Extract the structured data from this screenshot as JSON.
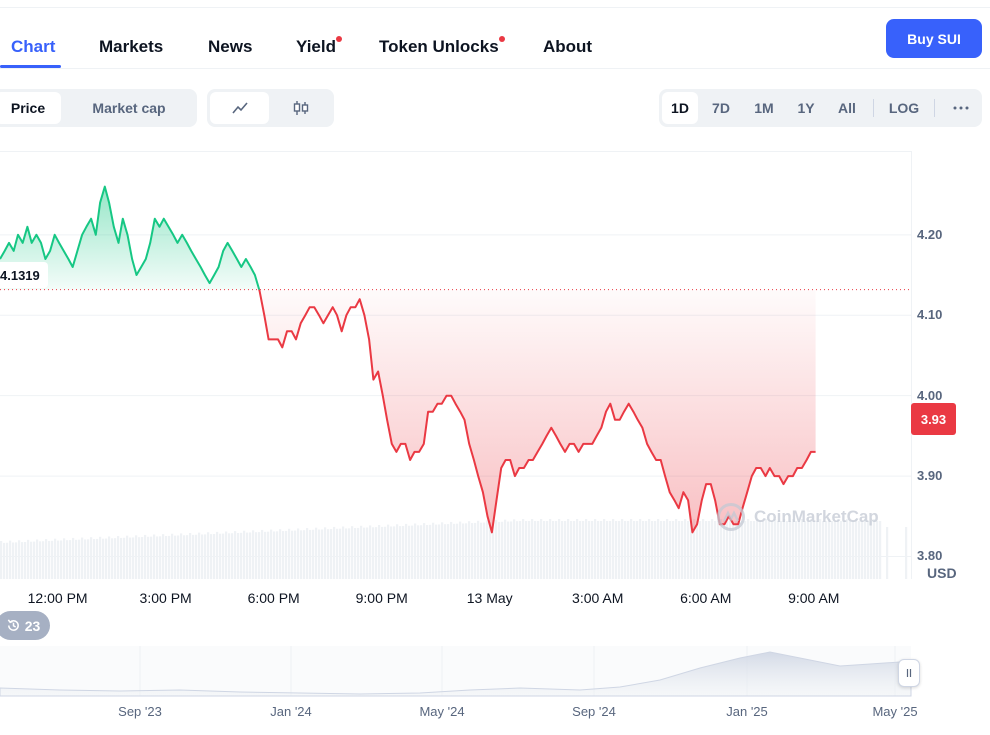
{
  "tabs": [
    {
      "label": "Chart",
      "active": true,
      "dot": false
    },
    {
      "label": "Markets",
      "active": false,
      "dot": false
    },
    {
      "label": "News",
      "active": false,
      "dot": false
    },
    {
      "label": "Yield",
      "active": false,
      "dot": true
    },
    {
      "label": "Token Unlocks",
      "active": false,
      "dot": true
    },
    {
      "label": "About",
      "active": false,
      "dot": false
    }
  ],
  "buy_button": "Buy SUI",
  "metric_toggle": {
    "price": "Price",
    "market_cap": "Market cap",
    "selected": "price"
  },
  "chart_style_icons": {
    "line": "line-chart-icon",
    "candle": "candlestick-icon",
    "selected": "line"
  },
  "ranges": [
    "1D",
    "7D",
    "1M",
    "1Y",
    "All"
  ],
  "selected_range": "1D",
  "log_label": "LOG",
  "more_icon": "more-horizontal-icon",
  "watermark": "CoinMarketCap",
  "history_badge": {
    "icon": "history-icon",
    "count": "23"
  },
  "colors": {
    "up": "#16c784",
    "down": "#ea3943",
    "accent": "#3861fb"
  },
  "chart_data": {
    "type": "line",
    "unit": "USD",
    "y_ticks": [
      "4.20",
      "4.10",
      "4.00",
      "3.90",
      "3.80"
    ],
    "ylim": [
      3.772,
      4.303
    ],
    "reference_price": 4.1319,
    "reference_label": "4.1319",
    "current_price": 3.93,
    "current_label": "3.93",
    "x_ticks": [
      "12:00 PM",
      "3:00 PM",
      "6:00 PM",
      "9:00 PM",
      "13 May",
      "3:00 AM",
      "6:00 AM",
      "9:00 AM"
    ],
    "x_tick_hours": [
      0,
      3,
      6,
      9,
      12,
      15,
      18,
      21
    ],
    "xlim_hours": [
      -1.6,
      23.7
    ],
    "series": [
      {
        "points": [
          [
            -1.6,
            4.17
          ],
          [
            -1.47,
            4.18
          ],
          [
            -1.35,
            4.19
          ],
          [
            -1.22,
            4.18
          ],
          [
            -1.1,
            4.2
          ],
          [
            -0.97,
            4.19
          ],
          [
            -0.84,
            4.21
          ],
          [
            -0.72,
            4.19
          ],
          [
            -0.59,
            4.2
          ],
          [
            -0.46,
            4.19
          ],
          [
            -0.34,
            4.17
          ],
          [
            -0.21,
            4.18
          ],
          [
            -0.08,
            4.2
          ],
          [
            0.04,
            4.19
          ],
          [
            0.17,
            4.18
          ],
          [
            0.3,
            4.17
          ],
          [
            0.42,
            4.16
          ],
          [
            0.55,
            4.18
          ],
          [
            0.68,
            4.2
          ],
          [
            0.8,
            4.21
          ],
          [
            0.93,
            4.22
          ],
          [
            1.06,
            4.2
          ],
          [
            1.18,
            4.24
          ],
          [
            1.31,
            4.26
          ],
          [
            1.43,
            4.24
          ],
          [
            1.56,
            4.21
          ],
          [
            1.69,
            4.19
          ],
          [
            1.81,
            4.22
          ],
          [
            1.94,
            4.2
          ],
          [
            2.07,
            4.17
          ],
          [
            2.19,
            4.15
          ],
          [
            2.32,
            4.16
          ],
          [
            2.45,
            4.17
          ],
          [
            2.57,
            4.19
          ],
          [
            2.7,
            4.22
          ],
          [
            2.83,
            4.21
          ],
          [
            2.95,
            4.22
          ],
          [
            3.08,
            4.21
          ],
          [
            3.21,
            4.2
          ],
          [
            3.33,
            4.19
          ],
          [
            3.46,
            4.2
          ],
          [
            3.59,
            4.19
          ],
          [
            3.71,
            4.18
          ],
          [
            3.84,
            4.17
          ],
          [
            3.97,
            4.16
          ],
          [
            4.09,
            4.15
          ],
          [
            4.22,
            4.14
          ],
          [
            4.35,
            4.15
          ],
          [
            4.47,
            4.16
          ],
          [
            4.6,
            4.18
          ],
          [
            4.72,
            4.19
          ],
          [
            4.85,
            4.18
          ],
          [
            4.98,
            4.17
          ],
          [
            5.1,
            4.16
          ],
          [
            5.23,
            4.17
          ],
          [
            5.36,
            4.16
          ],
          [
            5.48,
            4.15
          ],
          [
            5.61,
            4.13
          ],
          [
            5.74,
            4.1
          ],
          [
            5.86,
            4.07
          ],
          [
            5.99,
            4.07
          ],
          [
            6.12,
            4.07
          ],
          [
            6.24,
            4.06
          ],
          [
            6.37,
            4.08
          ],
          [
            6.5,
            4.08
          ],
          [
            6.62,
            4.07
          ],
          [
            6.75,
            4.09
          ],
          [
            6.88,
            4.1
          ],
          [
            7.0,
            4.11
          ],
          [
            7.13,
            4.11
          ],
          [
            7.26,
            4.1
          ],
          [
            7.38,
            4.09
          ],
          [
            7.51,
            4.1
          ],
          [
            7.64,
            4.11
          ],
          [
            7.76,
            4.1
          ],
          [
            7.89,
            4.08
          ],
          [
            8.02,
            4.1
          ],
          [
            8.14,
            4.11
          ],
          [
            8.27,
            4.11
          ],
          [
            8.39,
            4.12
          ],
          [
            8.52,
            4.1
          ],
          [
            8.65,
            4.07
          ],
          [
            8.77,
            4.02
          ],
          [
            8.9,
            4.03
          ],
          [
            9.03,
            4.0
          ],
          [
            9.15,
            3.97
          ],
          [
            9.28,
            3.94
          ],
          [
            9.41,
            3.93
          ],
          [
            9.53,
            3.94
          ],
          [
            9.66,
            3.94
          ],
          [
            9.79,
            3.92
          ],
          [
            9.91,
            3.93
          ],
          [
            10.04,
            3.93
          ],
          [
            10.17,
            3.94
          ],
          [
            10.29,
            3.98
          ],
          [
            10.42,
            3.98
          ],
          [
            10.55,
            3.99
          ],
          [
            10.67,
            3.99
          ],
          [
            10.8,
            4.0
          ],
          [
            10.93,
            4.0
          ],
          [
            11.05,
            3.99
          ],
          [
            11.18,
            3.98
          ],
          [
            11.3,
            3.97
          ],
          [
            11.43,
            3.94
          ],
          [
            11.56,
            3.92
          ],
          [
            11.68,
            3.9
          ],
          [
            11.81,
            3.88
          ],
          [
            11.94,
            3.85
          ],
          [
            12.06,
            3.83
          ],
          [
            12.19,
            3.87
          ],
          [
            12.32,
            3.91
          ],
          [
            12.44,
            3.92
          ],
          [
            12.57,
            3.92
          ],
          [
            12.7,
            3.9
          ],
          [
            12.82,
            3.91
          ],
          [
            12.95,
            3.91
          ],
          [
            13.08,
            3.92
          ],
          [
            13.2,
            3.92
          ],
          [
            13.33,
            3.93
          ],
          [
            13.46,
            3.94
          ],
          [
            13.58,
            3.95
          ],
          [
            13.71,
            3.96
          ],
          [
            13.84,
            3.95
          ],
          [
            13.96,
            3.94
          ],
          [
            14.09,
            3.93
          ],
          [
            14.22,
            3.94
          ],
          [
            14.34,
            3.94
          ],
          [
            14.47,
            3.93
          ],
          [
            14.6,
            3.94
          ],
          [
            14.72,
            3.94
          ],
          [
            14.85,
            3.94
          ],
          [
            14.97,
            3.95
          ],
          [
            15.1,
            3.96
          ],
          [
            15.23,
            3.98
          ],
          [
            15.35,
            3.99
          ],
          [
            15.48,
            3.97
          ],
          [
            15.61,
            3.97
          ],
          [
            15.73,
            3.98
          ],
          [
            15.86,
            3.99
          ],
          [
            15.99,
            3.98
          ],
          [
            16.11,
            3.97
          ],
          [
            16.24,
            3.96
          ],
          [
            16.37,
            3.94
          ],
          [
            16.49,
            3.93
          ],
          [
            16.62,
            3.92
          ],
          [
            16.75,
            3.92
          ],
          [
            16.87,
            3.9
          ],
          [
            17.0,
            3.88
          ],
          [
            17.13,
            3.87
          ],
          [
            17.25,
            3.86
          ],
          [
            17.38,
            3.88
          ],
          [
            17.51,
            3.87
          ],
          [
            17.63,
            3.83
          ],
          [
            17.76,
            3.84
          ],
          [
            17.89,
            3.87
          ],
          [
            18.01,
            3.89
          ],
          [
            18.14,
            3.89
          ],
          [
            18.26,
            3.87
          ],
          [
            18.39,
            3.84
          ],
          [
            18.52,
            3.84
          ],
          [
            18.64,
            3.85
          ],
          [
            18.77,
            3.84
          ],
          [
            18.9,
            3.84
          ],
          [
            19.02,
            3.86
          ],
          [
            19.15,
            3.88
          ],
          [
            19.28,
            3.9
          ],
          [
            19.4,
            3.91
          ],
          [
            19.53,
            3.91
          ],
          [
            19.66,
            3.9
          ],
          [
            19.78,
            3.91
          ],
          [
            19.91,
            3.9
          ],
          [
            20.04,
            3.9
          ],
          [
            20.16,
            3.89
          ],
          [
            20.29,
            3.9
          ],
          [
            20.42,
            3.9
          ],
          [
            20.54,
            3.91
          ],
          [
            20.67,
            3.91
          ],
          [
            20.8,
            3.92
          ],
          [
            20.92,
            3.93
          ],
          [
            21.05,
            3.93
          ]
        ]
      }
    ]
  },
  "brush": {
    "x_ticks": [
      "Sep '23",
      "Jan '24",
      "May '24",
      "Sep '24",
      "Jan '25",
      "May '25"
    ]
  }
}
